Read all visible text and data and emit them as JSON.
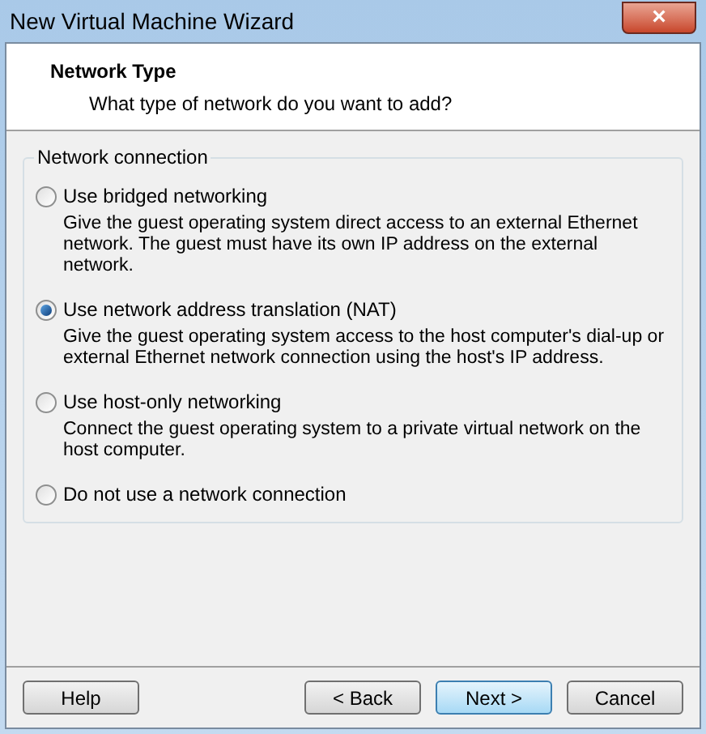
{
  "window": {
    "title": "New Virtual Machine Wizard",
    "close": "×"
  },
  "header": {
    "title": "Network Type",
    "subtitle": "What type of network do you want to add?"
  },
  "group": {
    "title": "Network connection",
    "options": [
      {
        "label": "Use bridged networking",
        "description": "Give the guest operating system direct access to an external Ethernet network. The guest must have its own IP address on the external network.",
        "selected": false
      },
      {
        "label": "Use network address translation (NAT)",
        "description": "Give the guest operating system access to the host computer's dial-up or external Ethernet network connection using the host's IP address.",
        "selected": true
      },
      {
        "label": "Use host-only networking",
        "description": "Connect the guest operating system to a private virtual network on the host computer.",
        "selected": false
      },
      {
        "label": "Do not use a network connection",
        "selected": false
      }
    ]
  },
  "buttons": [
    {
      "label": "Help",
      "kind": "left",
      "default": false
    },
    {
      "label": "< Back",
      "kind": "right",
      "default": false
    },
    {
      "label": "Next >",
      "kind": "right",
      "default": true
    },
    {
      "label": "Cancel",
      "kind": "right",
      "default": false
    }
  ]
}
